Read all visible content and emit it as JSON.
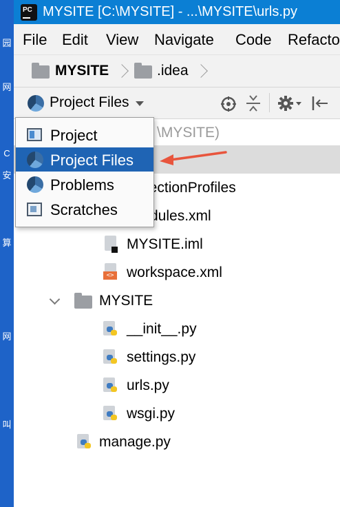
{
  "window": {
    "title": "MYSITE [C:\\MYSITE] - ...\\MYSITE\\urls.py",
    "logo_text": "PC"
  },
  "menu": [
    "File",
    "Edit",
    "View",
    "Navigate",
    "Code",
    "Refacto"
  ],
  "breadcrumb": [
    "MYSITE",
    ".idea"
  ],
  "toolbar": {
    "view_label": "Project Files"
  },
  "dropdown": {
    "items": [
      {
        "label": "Project",
        "icon": "project-icon",
        "selected": false
      },
      {
        "label": "Project Files",
        "icon": "pie-icon",
        "selected": true
      },
      {
        "label": "Problems",
        "icon": "pie-icon",
        "selected": false
      },
      {
        "label": "Scratches",
        "icon": "scratches-icon",
        "selected": false
      }
    ]
  },
  "tree": {
    "root_path_partial": "\\MYSITE)",
    "idea_children_partial": [
      "pectionProfiles",
      "dules.xml"
    ],
    "idea_files": [
      "MYSITE.iml",
      "workspace.xml"
    ],
    "package": {
      "name": "MYSITE",
      "files": [
        "__init__.py",
        "settings.py",
        "urls.py",
        "wsgi.py"
      ]
    },
    "root_file": "manage.py"
  },
  "desktop_strip": [
    "园",
    "网",
    "C",
    "安",
    "算",
    "网",
    "叫"
  ],
  "colors": {
    "titlebar": "#0b7fd4",
    "selection": "#1f64b4",
    "annotation_arrow": "#e8553d",
    "highlight_row": "#dcdcdc"
  }
}
